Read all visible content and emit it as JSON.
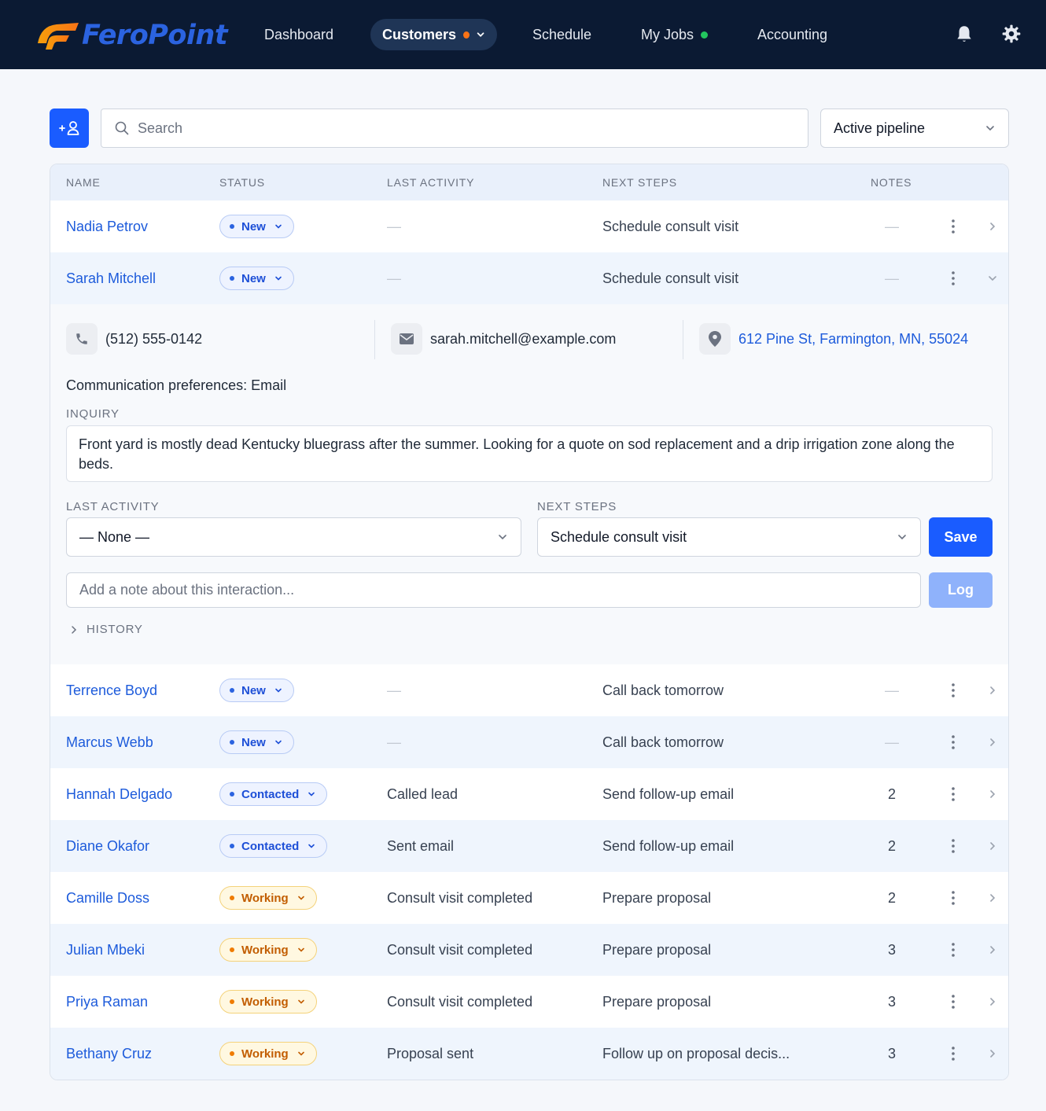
{
  "brand": {
    "name": "FeroPoint",
    "primary": "#1a5cff",
    "nav_bg": "#0b1a33",
    "accent_orange": "#f97316",
    "accent_green": "#22c55e"
  },
  "nav": {
    "items": [
      {
        "label": "Dashboard"
      },
      {
        "label": "Customers",
        "active": true,
        "badge": "orange-dot",
        "dropdown": true
      },
      {
        "label": "Schedule"
      },
      {
        "label": "My Jobs",
        "badge": "green-dot"
      },
      {
        "label": "Accounting"
      }
    ],
    "icons": [
      "bell-icon",
      "gear-icon"
    ]
  },
  "toolbar": {
    "add_icon": "add-user-icon",
    "search_placeholder": "Search",
    "pipeline_filter": "Active pipeline"
  },
  "table": {
    "columns": [
      "NAME",
      "STATUS",
      "LAST ACTIVITY",
      "NEXT STEPS",
      "NOTES"
    ],
    "rows": [
      {
        "name": "Nadia Petrov",
        "status": "New",
        "last_activity": "—",
        "next_steps": "Schedule consult visit",
        "notes": "—"
      },
      {
        "name": "Sarah Mitchell",
        "status": "New",
        "last_activity": "—",
        "next_steps": "Schedule consult visit",
        "notes": "—",
        "expanded": true
      },
      {
        "name": "Terrence Boyd",
        "status": "New",
        "last_activity": "—",
        "next_steps": "Call back tomorrow",
        "notes": "—"
      },
      {
        "name": "Marcus Webb",
        "status": "New",
        "last_activity": "—",
        "next_steps": "Call back tomorrow",
        "notes": "—"
      },
      {
        "name": "Hannah Delgado",
        "status": "Contacted",
        "last_activity": "Called lead",
        "next_steps": "Send follow-up email",
        "notes": "2"
      },
      {
        "name": "Diane Okafor",
        "status": "Contacted",
        "last_activity": "Sent email",
        "next_steps": "Send follow-up email",
        "notes": "2"
      },
      {
        "name": "Camille Doss",
        "status": "Working",
        "last_activity": "Consult visit completed",
        "next_steps": "Prepare proposal",
        "notes": "2"
      },
      {
        "name": "Julian Mbeki",
        "status": "Working",
        "last_activity": "Consult visit completed",
        "next_steps": "Prepare proposal",
        "notes": "3"
      },
      {
        "name": "Priya Raman",
        "status": "Working",
        "last_activity": "Consult visit completed",
        "next_steps": "Prepare proposal",
        "notes": "3"
      },
      {
        "name": "Bethany Cruz",
        "status": "Working",
        "last_activity": "Proposal sent",
        "next_steps": "Follow up on proposal decis...",
        "notes": "3"
      }
    ]
  },
  "detail": {
    "phone": "(512) 555-0142",
    "email": "sarah.mitchell@example.com",
    "address": "612 Pine St, Farmington, MN, 55024",
    "comm_prefs": "Communication preferences: Email",
    "inquiry_label": "INQUIRY",
    "inquiry_text": "Front yard is mostly dead Kentucky bluegrass after the summer. Looking for a quote on sod replacement and a drip irrigation zone along the beds.",
    "last_activity_label": "LAST ACTIVITY",
    "last_activity_value": "— None —",
    "next_steps_label": "NEXT STEPS",
    "next_steps_value": "Schedule consult visit",
    "save_label": "Save",
    "note_placeholder": "Add a note about this interaction...",
    "log_label": "Log",
    "history_label": "HISTORY"
  }
}
